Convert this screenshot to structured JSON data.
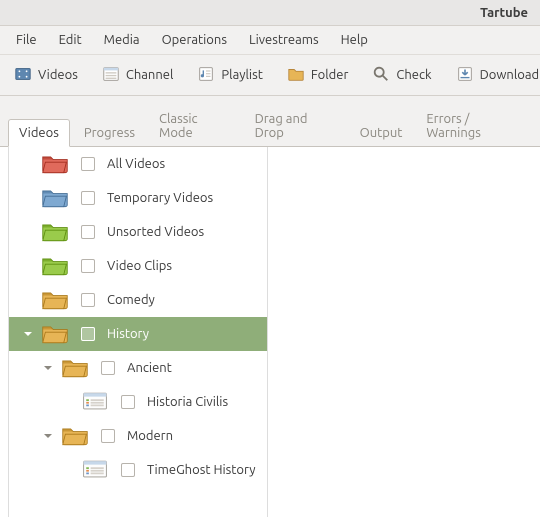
{
  "window": {
    "title": "Tartube"
  },
  "menu": {
    "items": [
      "File",
      "Edit",
      "Media",
      "Operations",
      "Livestreams",
      "Help"
    ]
  },
  "toolbar": {
    "items": [
      {
        "label": "Videos",
        "icon": "videos-icon"
      },
      {
        "label": "Channel",
        "icon": "channel-icon"
      },
      {
        "label": "Playlist",
        "icon": "playlist-icon"
      },
      {
        "label": "Folder",
        "icon": "folder-icon"
      },
      {
        "label": "Check",
        "icon": "check-icon"
      },
      {
        "label": "Download",
        "icon": "download-icon"
      }
    ]
  },
  "tabs": {
    "items": [
      "Videos",
      "Progress",
      "Classic Mode",
      "Drag and Drop",
      "Output",
      "Errors / Warnings"
    ],
    "active": 0
  },
  "tree": {
    "items": [
      {
        "label": "All Videos",
        "depth": 0,
        "kind": "folder",
        "color": "#e06a5c",
        "expander": "none",
        "selected": false
      },
      {
        "label": "Temporary Videos",
        "depth": 0,
        "kind": "folder",
        "color": "#7fa9d1",
        "expander": "none",
        "selected": false
      },
      {
        "label": "Unsorted Videos",
        "depth": 0,
        "kind": "folder",
        "color": "#9acb4b",
        "expander": "none",
        "selected": false
      },
      {
        "label": "Video Clips",
        "depth": 0,
        "kind": "folder",
        "color": "#9acb4b",
        "expander": "none",
        "selected": false
      },
      {
        "label": "Comedy",
        "depth": 0,
        "kind": "folder",
        "color": "#e7b556",
        "expander": "none",
        "selected": false
      },
      {
        "label": "History",
        "depth": 0,
        "kind": "folder",
        "color": "#e7b556",
        "expander": "open",
        "selected": true
      },
      {
        "label": "Ancient",
        "depth": 1,
        "kind": "folder",
        "color": "#e7b556",
        "expander": "open",
        "selected": false
      },
      {
        "label": "Historia Civilis",
        "depth": 2,
        "kind": "channel",
        "color": "#8aa6c1",
        "expander": "none",
        "selected": false
      },
      {
        "label": "Modern",
        "depth": 1,
        "kind": "folder",
        "color": "#e7b556",
        "expander": "open",
        "selected": false
      },
      {
        "label": "TimeGhost History",
        "depth": 2,
        "kind": "channel",
        "color": "#8aa6c1",
        "expander": "none",
        "selected": false
      }
    ]
  }
}
